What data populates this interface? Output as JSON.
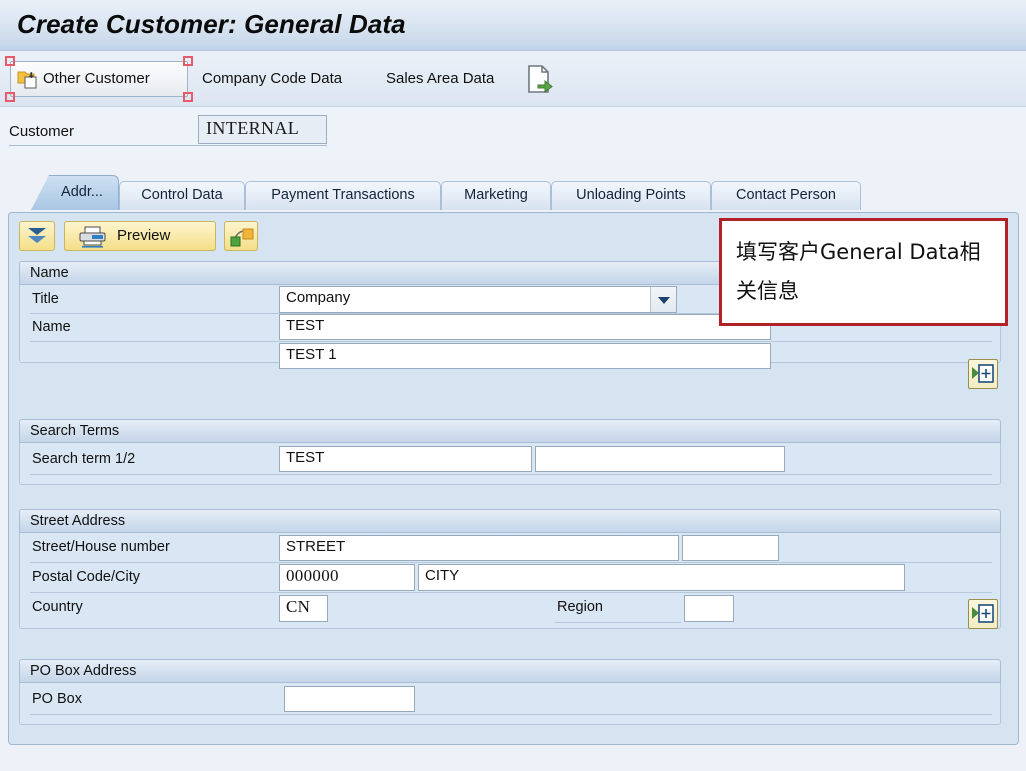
{
  "window": {
    "title": "Create Customer: General Data"
  },
  "toolbar": {
    "other_customer_label": "Other Customer",
    "company_code_data_label": "Company Code Data",
    "sales_area_data_label": "Sales Area Data",
    "folder_icon": "folder-page-icon",
    "document_export_icon": "document-arrow-icon"
  },
  "customer": {
    "label": "Customer",
    "value": "INTERNAL"
  },
  "tabs": [
    {
      "label": "Addr...",
      "active": true
    },
    {
      "label": "Control Data",
      "active": false
    },
    {
      "label": "Payment Transactions",
      "active": false
    },
    {
      "label": "Marketing",
      "active": false
    },
    {
      "label": "Unloading Points",
      "active": false
    },
    {
      "label": "Contact Person",
      "active": false
    }
  ],
  "panel_toolbar": {
    "collapse_icon": "double-chevron-down-icon",
    "preview_label": "Preview",
    "preview_icon": "printer-icon",
    "relationships_icon": "link-nodes-icon"
  },
  "groups": {
    "name": {
      "header": "Name",
      "title_label": "Title",
      "title_value": "Company",
      "name_label": "Name",
      "name_value": "TEST",
      "name2_value": "TEST 1",
      "expand_icon": "insert-row-icon"
    },
    "search_terms": {
      "header": "Search Terms",
      "search_term_label": "Search term 1/2",
      "search_term_1": "TEST",
      "search_term_2": ""
    },
    "street_address": {
      "header": "Street Address",
      "street_label": "Street/House number",
      "street_value": "STREET",
      "house_number_value": "",
      "postal_city_label": "Postal Code/City",
      "postal_code_value": "000000",
      "city_value": "CITY",
      "country_label": "Country",
      "country_value": "CN",
      "region_label": "Region",
      "region_value": "",
      "expand_icon": "insert-row-icon"
    },
    "po_box": {
      "header": "PO Box Address",
      "po_box_label": "PO Box",
      "po_box_value": ""
    }
  },
  "annotation": {
    "text": "填写客户General Data相关信息",
    "border_color": "#b02128"
  },
  "colors": {
    "title_bar": "#c9d9ea",
    "panel_bg": "#d6e4f2",
    "focus_outline": "#e8596a",
    "toolbar_button": "#f4de86"
  }
}
